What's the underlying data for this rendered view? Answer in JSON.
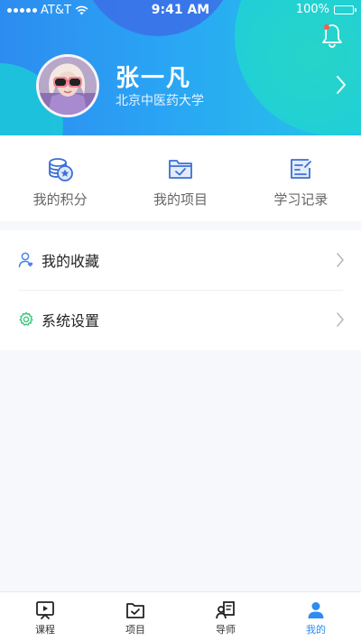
{
  "status_bar": {
    "carrier": "AT&T",
    "time": "9:41 AM",
    "battery": "100%"
  },
  "header": {
    "notification_icon": "bell-icon",
    "user_name": "张一凡",
    "school": "北京中医药大学"
  },
  "quick_actions": [
    {
      "label": "我的积分",
      "icon": "points-coin-icon"
    },
    {
      "label": "我的项目",
      "icon": "project-folder-icon"
    },
    {
      "label": "学习记录",
      "icon": "study-record-icon"
    }
  ],
  "menu": [
    {
      "label": "我的收藏",
      "icon": "user-heart-icon"
    },
    {
      "label": "系统设置",
      "icon": "gear-icon"
    }
  ],
  "tabbar": {
    "active": "我的",
    "tabs": [
      {
        "label": "课程",
        "icon": "play-board-icon"
      },
      {
        "label": "项目",
        "icon": "folder-check-icon"
      },
      {
        "label": "导师",
        "icon": "mentor-icon"
      },
      {
        "label": "我的",
        "icon": "person-icon"
      }
    ]
  },
  "colors": {
    "accent": "#2d8cf0",
    "header_start": "#2d8cf0",
    "header_end": "#25c6e8",
    "settings_green": "#3cc47c"
  }
}
